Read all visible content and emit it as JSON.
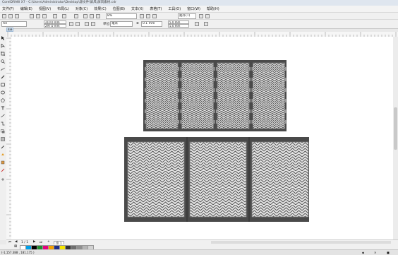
{
  "app": {
    "title": "CorelDRAW X7 - C:\\Users\\Administrator\\Desktop\\源文件\\屏风\\屏风素材.cdr"
  },
  "menu": [
    "文件(F)",
    "编辑(E)",
    "视图(V)",
    "布局(L)",
    "对象(C)",
    "效果(C)",
    "位图(B)",
    "文本(X)",
    "表格(T)",
    "工具(O)",
    "窗口(W)",
    "帮助(H)"
  ],
  "toolbar": {
    "zoom": "8%",
    "snap_label": "贴齐(T)"
  },
  "propertybar": {
    "page_size": "A4",
    "width": "210.0 mm",
    "height": "297.0 mm",
    "units_label": "单位:",
    "units_value": "毫米",
    "nudge": "0.1 mm",
    "dup_x": "5.0 mm",
    "dup_y": "5.0 mm"
  },
  "document": {
    "tab_label": "未命名"
  },
  "pages": {
    "current": "1 / 1",
    "tab": "页 1"
  },
  "status": {
    "coords": "(-1,157.388 , 181.175 )"
  },
  "colors": {
    "panel_frame": "#4a4a4a",
    "panel_border": "#7b7b7b",
    "pattern_bg": "#e2e2e2",
    "pattern_line": "#4e4e4e",
    "canvas": "#ffffff"
  },
  "palette": [
    "#ffffff",
    "#00a0e9",
    "#000000",
    "#1e8c2e",
    "#e4007f",
    "#f3a000",
    "#1f2e86",
    "#f5e500",
    "#333333",
    "#6e6e6e",
    "#8f8f8f",
    "#b4b4b4",
    "#d2d2d2"
  ]
}
